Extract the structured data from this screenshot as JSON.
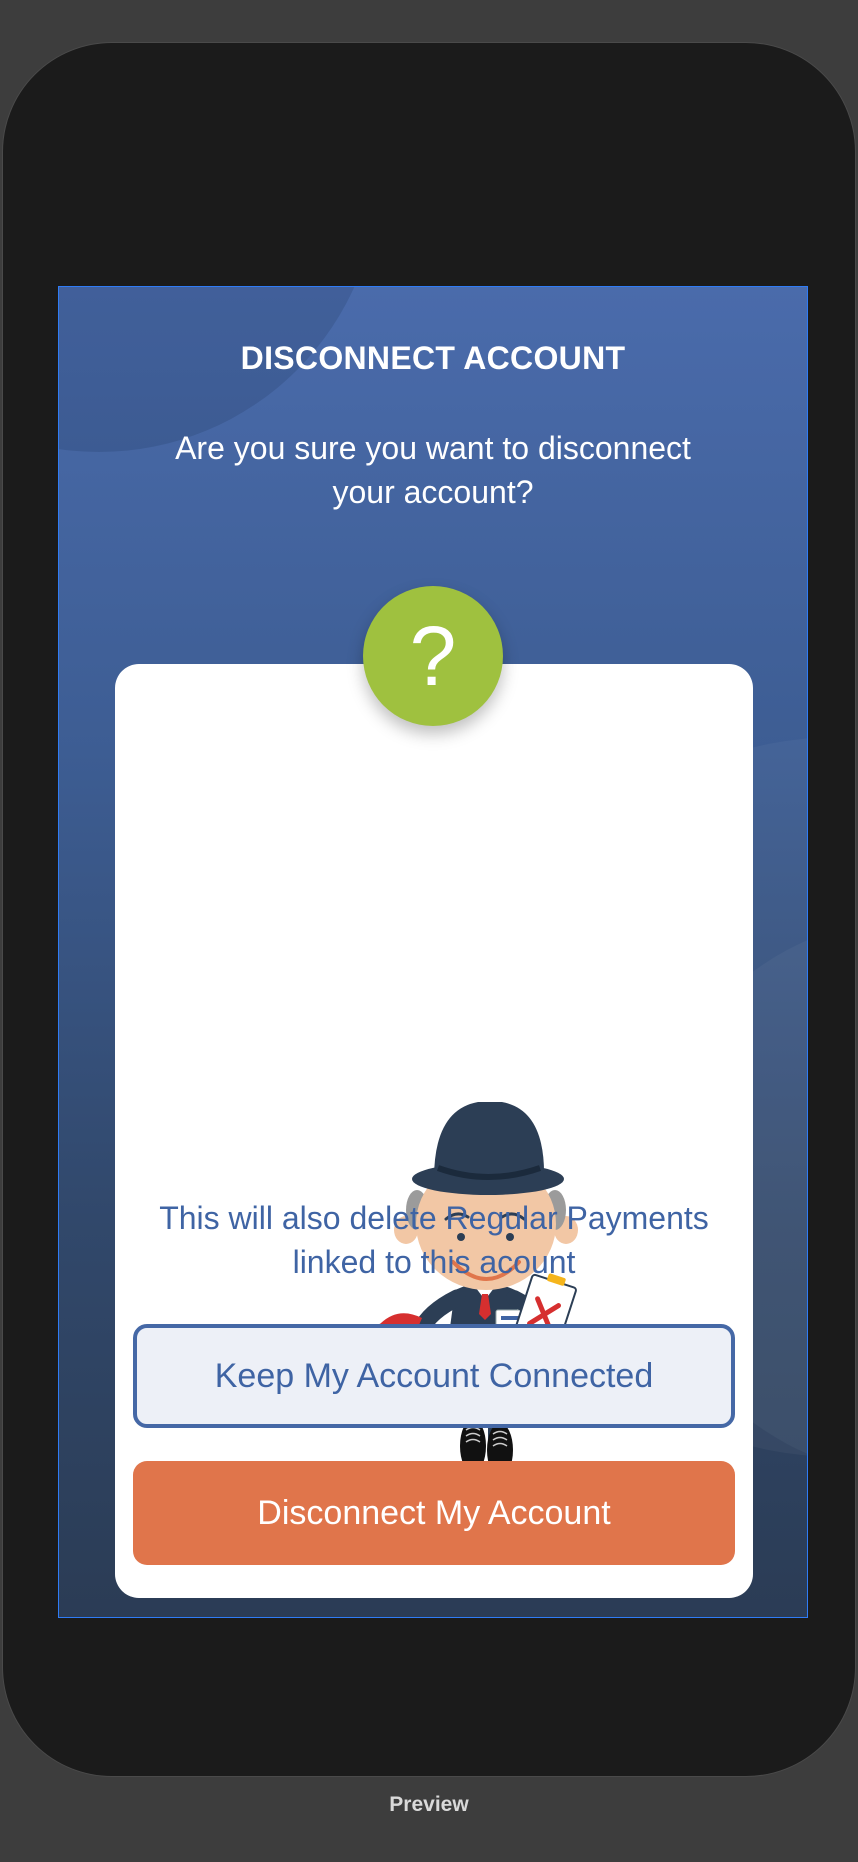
{
  "dialog": {
    "title": "DISCONNECT ACCOUNT",
    "question": "Are you sure you want to disconnect your account?",
    "badge_symbol": "?",
    "illustration": "bowler-hat-man-illustration",
    "note": "This will also delete Regular Payments linked to this acount",
    "keep_label": "Keep My Account Connected",
    "disconnect_label": "Disconnect My Account"
  },
  "colors": {
    "primary_blue": "#3f64a4",
    "badge_green": "#9fc13f",
    "danger_orange": "#e0754b"
  },
  "footer": {
    "caption": "Preview"
  }
}
